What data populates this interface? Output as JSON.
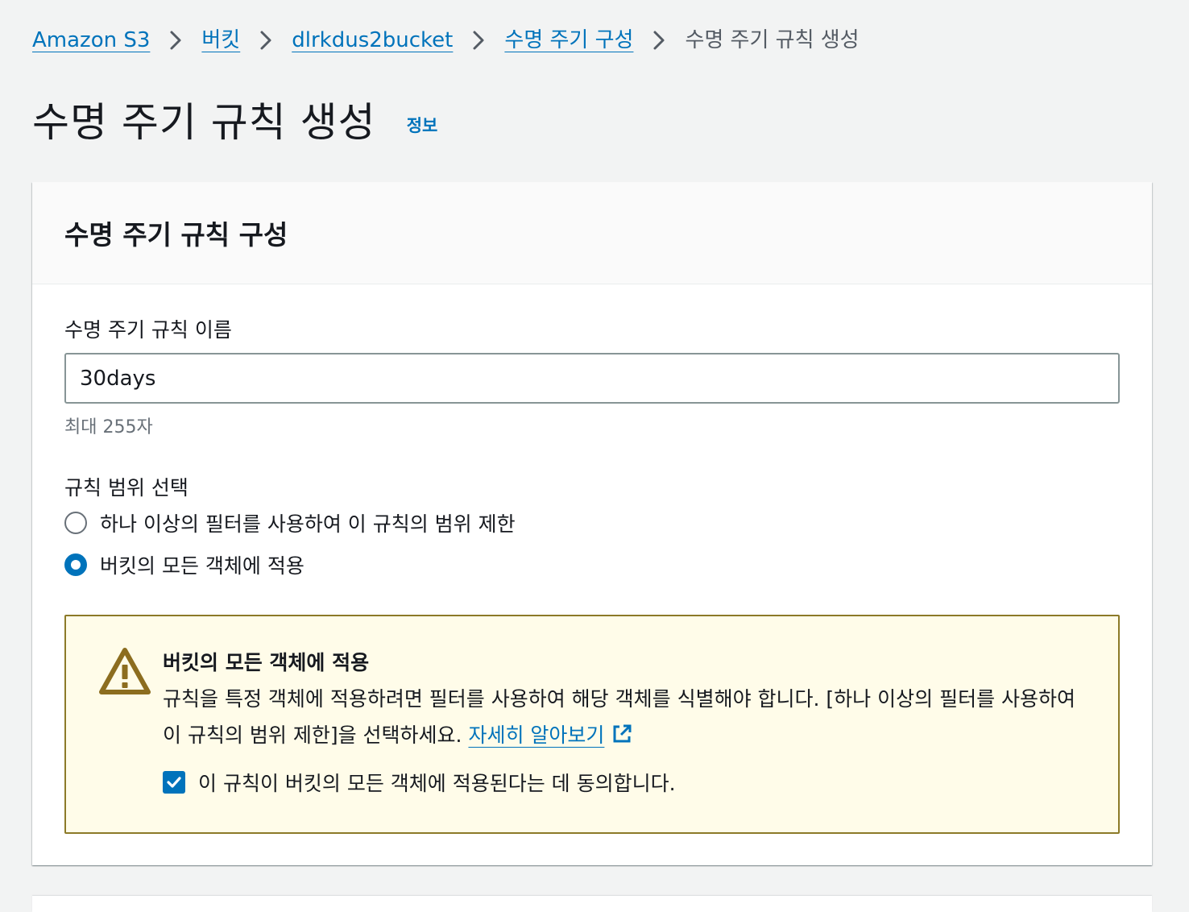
{
  "breadcrumb": {
    "items": [
      {
        "label": "Amazon S3"
      },
      {
        "label": "버킷"
      },
      {
        "label": "dlrkdus2bucket"
      },
      {
        "label": "수명 주기 구성"
      }
    ],
    "current": "수명 주기 규칙 생성"
  },
  "page": {
    "title": "수명 주기 규칙 생성",
    "info_label": "정보"
  },
  "panel": {
    "title": "수명 주기 규칙 구성",
    "rule_name": {
      "label": "수명 주기 규칙 이름",
      "value": "30days",
      "hint": "최대 255자"
    },
    "scope": {
      "label": "규칙 범위 선택",
      "options": [
        {
          "label": "하나 이상의 필터를 사용하여 이 규칙의 범위 제한",
          "selected": false
        },
        {
          "label": "버킷의 모든 객체에 적용",
          "selected": true
        }
      ]
    },
    "warning": {
      "title": "버킷의 모든 객체에 적용",
      "text": "규칙을 특정 객체에 적용하려면 필터를 사용하여 해당 객체를 식별해야 합니다. [하나 이상의 필터를 사용하여 이 규칙의 범위 제한]을 선택하세요.",
      "link_label": "자세히 알아보기",
      "ack_label": "이 규칙이 버킷의 모든 객체에 적용된다는 데 동의합니다.",
      "ack_checked": true
    }
  },
  "colors": {
    "link": "#0073bb",
    "warning_bg": "#fffce9",
    "warning_border": "#8c7a28",
    "warning_icon": "#8c6d1f"
  }
}
